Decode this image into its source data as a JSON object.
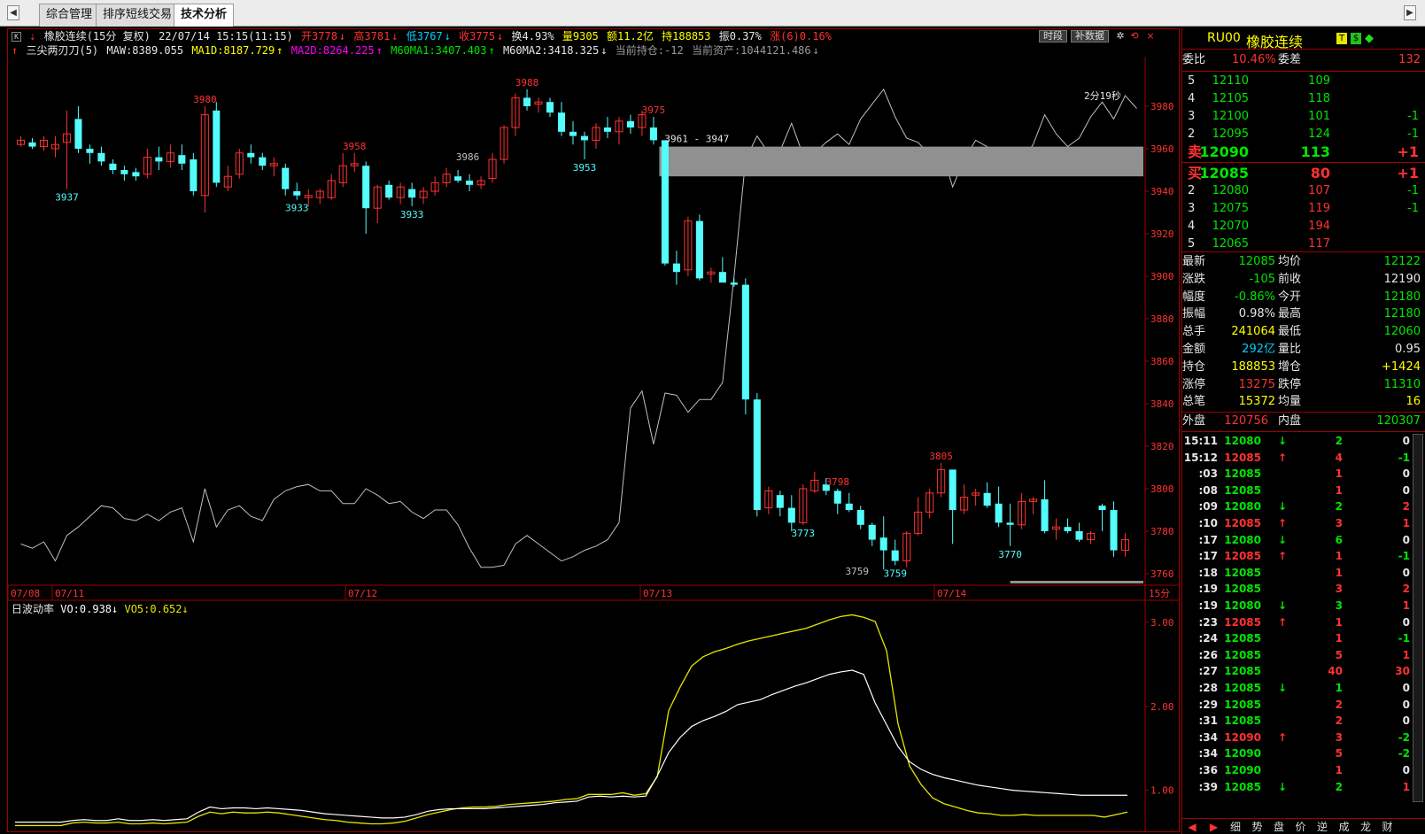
{
  "tabs": [
    {
      "label": "综合管理"
    },
    {
      "label": "排序短线交易"
    },
    {
      "label": "技术分析"
    }
  ],
  "nav": {
    "left_arrow": "◀",
    "right_arrow": "▶"
  },
  "header": {
    "title": "橡胶连续(15分 复权)",
    "datetime": "22/07/14 15:15(11:15)",
    "open": "开3778",
    "high": "高3781",
    "low": "低3767",
    "close": "收3775",
    "turnover": "换4.93%",
    "volume": "量9305",
    "amount": "额11.2亿",
    "position": "持188853",
    "amplitude": "振0.37%",
    "change": "涨(6)0.16%",
    "btn_period": "时段",
    "btn_supplement": "补数据",
    "formula_name": "三尖两刃刀(5)",
    "maw": "MAW:8389.055",
    "ma1d": "MA1D:8187.729",
    "ma2d": "MA2D:8264.225",
    "m60ma1": "M60MA1:3407.403",
    "m60ma2": "M60MA2:3418.325",
    "hold": "当前持仓:-12",
    "asset": "当前资产:1044121.486"
  },
  "price_axis": [
    "3980",
    "3960",
    "3940",
    "3920",
    "3900",
    "3880",
    "3860",
    "3840",
    "3820",
    "3800",
    "3780",
    "3760"
  ],
  "date_axis": [
    {
      "label": "07/08"
    },
    {
      "label": "07/11"
    },
    {
      "label": "07/12"
    },
    {
      "label": "07/13"
    },
    {
      "label": "07/14"
    }
  ],
  "period_label": "15分",
  "annotations": {
    "timer": "2分19秒",
    "range_label": "3961 - 3947",
    "labels": [
      "3980",
      "3937",
      "3958",
      "3933",
      "3933",
      "3986",
      "3988",
      "3953",
      "3975",
      "3798",
      "3773",
      "3805",
      "3759",
      "3759",
      "3770"
    ]
  },
  "indicator": {
    "name": "日波动率",
    "vo": "VO:0.938",
    "vo5": "VO5:0.652",
    "axis": [
      "3.00",
      "2.00",
      "1.00"
    ]
  },
  "quote": {
    "code": "RU00",
    "name": "橡胶连续",
    "wb_label": "委比",
    "wb_value": "10.46%",
    "wc_label": "委差",
    "wc_value": "132",
    "asks": [
      {
        "lvl": "5",
        "price": "12110",
        "vol": "109",
        "chg": ""
      },
      {
        "lvl": "4",
        "price": "12105",
        "vol": "118",
        "chg": ""
      },
      {
        "lvl": "3",
        "price": "12100",
        "vol": "101",
        "chg": "-1"
      },
      {
        "lvl": "2",
        "price": "12095",
        "vol": "124",
        "chg": "-1"
      },
      {
        "lvl": "卖",
        "price": "12090",
        "vol": "113",
        "chg": "+1"
      }
    ],
    "bids": [
      {
        "lvl": "买",
        "price": "12085",
        "vol": "80",
        "chg": "+1"
      },
      {
        "lvl": "2",
        "price": "12080",
        "vol": "107",
        "chg": "-1"
      },
      {
        "lvl": "3",
        "price": "12075",
        "vol": "119",
        "chg": "-1"
      },
      {
        "lvl": "4",
        "price": "12070",
        "vol": "194",
        "chg": ""
      },
      {
        "lvl": "5",
        "price": "12065",
        "vol": "117",
        "chg": ""
      }
    ],
    "stats": [
      {
        "l1": "最新",
        "v1": "12085",
        "c1": "grn",
        "l2": "均价",
        "v2": "12122",
        "c2": "grn"
      },
      {
        "l1": "涨跌",
        "v1": "-105",
        "c1": "grn",
        "l2": "前收",
        "v2": "12190",
        "c2": "wht"
      },
      {
        "l1": "幅度",
        "v1": "-0.86%",
        "c1": "grn",
        "l2": "今开",
        "v2": "12180",
        "c2": "grn"
      },
      {
        "l1": "振幅",
        "v1": "0.98%",
        "c1": "wht",
        "l2": "最高",
        "v2": "12180",
        "c2": "grn"
      },
      {
        "l1": "总手",
        "v1": "241064",
        "c1": "yel",
        "l2": "最低",
        "v2": "12060",
        "c2": "grn"
      },
      {
        "l1": "金额",
        "v1": "292亿",
        "c1": "cyan",
        "l2": "量比",
        "v2": "0.95",
        "c2": "wht"
      },
      {
        "l1": "持仓",
        "v1": "188853",
        "c1": "yel",
        "l2": "增仓",
        "v2": "+1424",
        "c2": "yel"
      },
      {
        "l1": "涨停",
        "v1": "13275",
        "c1": "red",
        "l2": "跌停",
        "v2": "11310",
        "c2": "grn"
      },
      {
        "l1": "总笔",
        "v1": "15372",
        "c1": "yel",
        "l2": "均量",
        "v2": "16",
        "c2": "yel"
      }
    ],
    "outer_label": "外盘",
    "outer_value": "120756",
    "inner_label": "内盘",
    "inner_value": "120307",
    "ticks": [
      {
        "t": "15:11",
        "p": "12080",
        "dir": "↓",
        "v": "2",
        "o": "0"
      },
      {
        "t": "15:12",
        "p": "12085",
        "dir": "↑",
        "v": "4",
        "o": "-1"
      },
      {
        "t": ":03",
        "p": "12085",
        "dir": "",
        "v": "1",
        "o": "0"
      },
      {
        "t": ":08",
        "p": "12085",
        "dir": "",
        "v": "1",
        "o": "0"
      },
      {
        "t": ":09",
        "p": "12080",
        "dir": "↓",
        "v": "2",
        "o": "2"
      },
      {
        "t": ":10",
        "p": "12085",
        "dir": "↑",
        "v": "3",
        "o": "1"
      },
      {
        "t": ":17",
        "p": "12080",
        "dir": "↓",
        "v": "6",
        "o": "0"
      },
      {
        "t": ":17",
        "p": "12085",
        "dir": "↑",
        "v": "1",
        "o": "-1"
      },
      {
        "t": ":18",
        "p": "12085",
        "dir": "",
        "v": "1",
        "o": "0"
      },
      {
        "t": ":19",
        "p": "12085",
        "dir": "",
        "v": "3",
        "o": "2"
      },
      {
        "t": ":19",
        "p": "12080",
        "dir": "↓",
        "v": "3",
        "o": "1"
      },
      {
        "t": ":23",
        "p": "12085",
        "dir": "↑",
        "v": "1",
        "o": "0"
      },
      {
        "t": ":24",
        "p": "12085",
        "dir": "",
        "v": "1",
        "o": "-1"
      },
      {
        "t": ":26",
        "p": "12085",
        "dir": "",
        "v": "5",
        "o": "1"
      },
      {
        "t": ":27",
        "p": "12085",
        "dir": "",
        "v": "40",
        "o": "30"
      },
      {
        "t": ":28",
        "p": "12085",
        "dir": "↓",
        "v": "1",
        "o": "0"
      },
      {
        "t": ":29",
        "p": "12085",
        "dir": "",
        "v": "2",
        "o": "0"
      },
      {
        "t": ":31",
        "p": "12085",
        "dir": "",
        "v": "2",
        "o": "0"
      },
      {
        "t": ":34",
        "p": "12090",
        "dir": "↑",
        "v": "3",
        "o": "-2"
      },
      {
        "t": ":34",
        "p": "12090",
        "dir": "",
        "v": "5",
        "o": "-2"
      },
      {
        "t": ":36",
        "p": "12090",
        "dir": "",
        "v": "1",
        "o": "0"
      },
      {
        "t": ":39",
        "p": "12085",
        "dir": "↓",
        "v": "2",
        "o": "1"
      }
    ],
    "bottom_tabs": [
      "◀",
      "▶",
      "细",
      "势",
      "盘",
      "价",
      "逆",
      "成",
      "龙",
      "财"
    ]
  },
  "colors": {
    "up": "#ff3232",
    "down": "#54fcfc",
    "frame": "#9e0000",
    "ma": "#c0c0c0",
    "vo": "#ffffff",
    "vo5": "#e6e600"
  },
  "chart_data": {
    "type": "candlestick",
    "ylim": [
      3755,
      3995
    ],
    "candles": [
      [
        3962,
        3966,
        3961,
        3964
      ],
      [
        3963,
        3965,
        3960,
        3961
      ],
      [
        3961,
        3966,
        3959,
        3964
      ],
      [
        3960,
        3966,
        3956,
        3962
      ],
      [
        3963,
        3978,
        3941,
        3967
      ],
      [
        3974,
        3980,
        3958,
        3960
      ],
      [
        3960,
        3962,
        3953,
        3958
      ],
      [
        3958,
        3961,
        3952,
        3954
      ],
      [
        3953,
        3955,
        3948,
        3950
      ],
      [
        3950,
        3952,
        3945,
        3948
      ],
      [
        3949,
        3951,
        3945,
        3947
      ],
      [
        3948,
        3960,
        3946,
        3956
      ],
      [
        3956,
        3961,
        3950,
        3954
      ],
      [
        3954,
        3962,
        3951,
        3958
      ],
      [
        3957,
        3962,
        3950,
        3953
      ],
      [
        3955,
        3958,
        3938,
        3940
      ],
      [
        3938,
        3980,
        3930,
        3976
      ],
      [
        3978,
        3982,
        3942,
        3944
      ],
      [
        3942,
        3952,
        3940,
        3947
      ],
      [
        3948,
        3960,
        3946,
        3958
      ],
      [
        3958,
        3962,
        3953,
        3956
      ],
      [
        3956,
        3958,
        3950,
        3952
      ],
      [
        3952,
        3956,
        3947,
        3953
      ],
      [
        3951,
        3953,
        3938,
        3941
      ],
      [
        3940,
        3944,
        3936,
        3938
      ],
      [
        3937,
        3941,
        3933,
        3938
      ],
      [
        3937,
        3941,
        3934,
        3940
      ],
      [
        3937,
        3948,
        3936,
        3945
      ],
      [
        3944,
        3958,
        3942,
        3952
      ],
      [
        3952,
        3958,
        3949,
        3953
      ],
      [
        3952,
        3954,
        3920,
        3932
      ],
      [
        3932,
        3943,
        3925,
        3942
      ],
      [
        3943,
        3945,
        3936,
        3937
      ],
      [
        3937,
        3944,
        3934,
        3942
      ],
      [
        3941,
        3944,
        3933,
        3937
      ],
      [
        3937,
        3942,
        3934,
        3940
      ],
      [
        3940,
        3947,
        3938,
        3944
      ],
      [
        3944,
        3951,
        3942,
        3948
      ],
      [
        3947,
        3950,
        3944,
        3945
      ],
      [
        3945,
        3948,
        3940,
        3943
      ],
      [
        3943,
        3947,
        3941,
        3945
      ],
      [
        3946,
        3958,
        3944,
        3955
      ],
      [
        3955,
        3971,
        3953,
        3970
      ],
      [
        3970,
        3986,
        3966,
        3984
      ],
      [
        3984,
        3988,
        3978,
        3980
      ],
      [
        3981,
        3984,
        3977,
        3982
      ],
      [
        3982,
        3984,
        3975,
        3977
      ],
      [
        3977,
        3982,
        3966,
        3968
      ],
      [
        3968,
        3973,
        3962,
        3966
      ],
      [
        3966,
        3968,
        3955,
        3964
      ],
      [
        3964,
        3972,
        3960,
        3970
      ],
      [
        3970,
        3975,
        3965,
        3968
      ],
      [
        3968,
        3975,
        3962,
        3973
      ],
      [
        3973,
        3976,
        3967,
        3970
      ],
      [
        3970,
        3978,
        3966,
        3976
      ],
      [
        3970,
        3975,
        3962,
        3964
      ],
      [
        3964,
        3948,
        3905,
        3906
      ],
      [
        3906,
        3912,
        3896,
        3902
      ],
      [
        3903,
        3928,
        3900,
        3926
      ],
      [
        3926,
        3929,
        3898,
        3899
      ],
      [
        3901,
        3904,
        3897,
        3902
      ],
      [
        3902,
        3909,
        3898,
        3897
      ],
      [
        3897,
        3899,
        3895,
        3896
      ],
      [
        3896,
        3899,
        3835,
        3842
      ],
      [
        3842,
        3845,
        3787,
        3790
      ],
      [
        3791,
        3801,
        3788,
        3799
      ],
      [
        3797,
        3799,
        3787,
        3791
      ],
      [
        3791,
        3797,
        3780,
        3784
      ],
      [
        3784,
        3802,
        3783,
        3800
      ],
      [
        3799,
        3808,
        3798,
        3804
      ],
      [
        3802,
        3805,
        3797,
        3799
      ],
      [
        3799,
        3800,
        3788,
        3793
      ],
      [
        3793,
        3798,
        3789,
        3790
      ],
      [
        3790,
        3792,
        3781,
        3783
      ],
      [
        3783,
        3784,
        3773,
        3776
      ],
      [
        3777,
        3787,
        3762,
        3771
      ],
      [
        3771,
        3776,
        3764,
        3766
      ],
      [
        3766,
        3780,
        3763,
        3779
      ],
      [
        3779,
        3796,
        3778,
        3789
      ],
      [
        3789,
        3800,
        3786,
        3798
      ],
      [
        3798,
        3812,
        3796,
        3809
      ],
      [
        3809,
        3805,
        3774,
        3790
      ],
      [
        3790,
        3802,
        3788,
        3796
      ],
      [
        3797,
        3800,
        3792,
        3798
      ],
      [
        3798,
        3803,
        3791,
        3792
      ],
      [
        3793,
        3801,
        3782,
        3784
      ],
      [
        3784,
        3793,
        3773,
        3783
      ],
      [
        3783,
        3798,
        3781,
        3794
      ],
      [
        3794,
        3796,
        3788,
        3795
      ],
      [
        3795,
        3804,
        3779,
        3780
      ],
      [
        3781,
        3786,
        3776,
        3782
      ],
      [
        3782,
        3786,
        3779,
        3780
      ],
      [
        3780,
        3784,
        3775,
        3776
      ],
      [
        3776,
        3780,
        3774,
        3779
      ],
      [
        3792,
        3793,
        3780,
        3790
      ],
      [
        3790,
        3794,
        3768,
        3771
      ],
      [
        3771,
        3779,
        3768,
        3776
      ]
    ],
    "ma_line": [
      3774,
      3772,
      3775,
      3766,
      3778,
      3782,
      3787,
      3792,
      3791,
      3786,
      3785,
      3788,
      3785,
      3789,
      3791,
      3775,
      3800,
      3782,
      3790,
      3792,
      3787,
      3785,
      3795,
      3799,
      3801,
      3802,
      3799,
      3799,
      3793,
      3793,
      3800,
      3797,
      3793,
      3794,
      3789,
      3786,
      3790,
      3790,
      3783,
      3772,
      3763,
      3763,
      3764,
      3774,
      3778,
      3774,
      3770,
      3766,
      3768,
      3771,
      3773,
      3776,
      3784,
      3838,
      3846,
      3821,
      3845,
      3844,
      3836,
      3842,
      3842,
      3850,
      3900,
      3955,
      3966,
      3958,
      3959,
      3972,
      3957,
      3958,
      3963,
      3967,
      3962,
      3974,
      3981,
      3988,
      3975,
      3965,
      3963,
      3957,
      3960,
      3942,
      3955,
      3964,
      3961,
      3955,
      3949,
      3954,
      3962,
      3976,
      3967,
      3961,
      3965,
      3975,
      3982,
      3974,
      3985,
      3979
    ],
    "vo": [
      0.62,
      0.62,
      0.62,
      0.62,
      0.62,
      0.64,
      0.65,
      0.64,
      0.64,
      0.66,
      0.64,
      0.64,
      0.65,
      0.64,
      0.65,
      0.66,
      0.74,
      0.8,
      0.78,
      0.79,
      0.79,
      0.78,
      0.79,
      0.78,
      0.77,
      0.76,
      0.74,
      0.72,
      0.71,
      0.7,
      0.69,
      0.68,
      0.67,
      0.67,
      0.68,
      0.71,
      0.75,
      0.77,
      0.78,
      0.78,
      0.78,
      0.78,
      0.79,
      0.8,
      0.81,
      0.82,
      0.83,
      0.85,
      0.86,
      0.87,
      0.92,
      0.93,
      0.92,
      0.93,
      0.92,
      0.93,
      1.17,
      1.45,
      1.63,
      1.76,
      1.83,
      1.88,
      1.94,
      2.02,
      2.05,
      2.08,
      2.14,
      2.19,
      2.24,
      2.28,
      2.33,
      2.38,
      2.41,
      2.43,
      2.38,
      2.04,
      1.78,
      1.52,
      1.34,
      1.25,
      1.19,
      1.15,
      1.12,
      1.09,
      1.06,
      1.04,
      1.02,
      1.0,
      0.99,
      0.98,
      0.97,
      0.96,
      0.95,
      0.94,
      0.94,
      0.94,
      0.94,
      0.94
    ],
    "vo5": [
      0.58,
      0.58,
      0.58,
      0.58,
      0.58,
      0.61,
      0.62,
      0.61,
      0.61,
      0.62,
      0.6,
      0.6,
      0.61,
      0.6,
      0.61,
      0.62,
      0.69,
      0.74,
      0.72,
      0.74,
      0.73,
      0.73,
      0.74,
      0.73,
      0.71,
      0.69,
      0.67,
      0.65,
      0.64,
      0.62,
      0.61,
      0.6,
      0.6,
      0.61,
      0.63,
      0.67,
      0.71,
      0.74,
      0.77,
      0.79,
      0.8,
      0.8,
      0.81,
      0.83,
      0.84,
      0.85,
      0.86,
      0.87,
      0.89,
      0.9,
      0.95,
      0.95,
      0.95,
      0.97,
      0.94,
      0.96,
      1.16,
      1.95,
      2.23,
      2.48,
      2.59,
      2.65,
      2.69,
      2.74,
      2.78,
      2.81,
      2.84,
      2.87,
      2.9,
      2.93,
      2.98,
      3.03,
      3.07,
      3.09,
      3.06,
      3.01,
      2.66,
      1.79,
      1.29,
      1.07,
      0.91,
      0.84,
      0.8,
      0.76,
      0.73,
      0.72,
      0.7,
      0.7,
      0.71,
      0.7,
      0.7,
      0.7,
      0.7,
      0.7,
      0.7,
      0.68,
      0.71,
      0.74
    ]
  }
}
